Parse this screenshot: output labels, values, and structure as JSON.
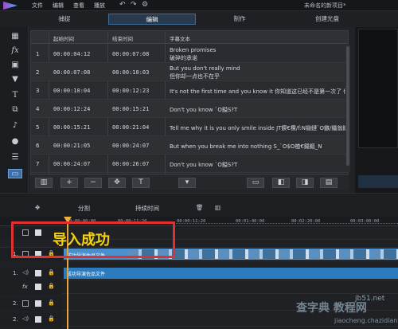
{
  "menu": {
    "items": [
      "文件",
      "编辑",
      "查看",
      "播放"
    ],
    "project_title": "未命名的新项目*"
  },
  "modes": [
    "捕捉",
    "编辑",
    "制作",
    "创建光盘"
  ],
  "active_mode": "编辑",
  "left_toolbar": {
    "icons": [
      "media-icon",
      "fx-icon",
      "overlay-icon",
      "color-icon",
      "title-icon",
      "transition-icon",
      "audio-icon",
      "record-icon",
      "chapter-icon",
      "subtitle-icon"
    ]
  },
  "subtitle_table": {
    "headers": {
      "start": "起始时间",
      "end": "结束时间",
      "text": "字幕文本"
    },
    "rows": [
      {
        "num": "1",
        "start": "00:00:04:12",
        "end": "00:00:07:08",
        "line1": "Broken promises",
        "line2": "破碎的承诺"
      },
      {
        "num": "2",
        "start": "00:00:07:08",
        "end": "00:00:10:03",
        "line1": "But you don't really mind",
        "line2": "但你却一点也不在乎"
      },
      {
        "num": "3",
        "start": "00:00:10:04",
        "end": "00:00:12:23",
        "line1": "It's not the first time and you know it 你知道这已经不是第一次了 你明白",
        "line2": ""
      },
      {
        "num": "4",
        "start": "00:00:12:24",
        "end": "00:00:15:21",
        "line1": "Don't you know `O鎰S?T",
        "line2": ""
      },
      {
        "num": "5",
        "start": "00:00:15:21",
        "end": "00:00:21:04",
        "line1": "Tell me why it is you only smile inside JT鍥€欑/f:N锄鏈`O鏃/鑷翁鐩",
        "line2": ""
      },
      {
        "num": "6",
        "start": "00:00:21:05",
        "end": "00:00:24:07",
        "line1": "But when you break me into nothing S_`O$O楂€鍚鏂_N",
        "line2": ""
      },
      {
        "num": "7",
        "start": "00:00:24:07",
        "end": "00:00:26:07",
        "line1": "Don't you know `O鎰S?T",
        "line2": ""
      }
    ]
  },
  "table_buttons": [
    "+",
    "−",
    "✥",
    "T",
    "▾"
  ],
  "timeline_tools": {
    "split": "分割",
    "duration": "持续时间"
  },
  "ruler_ticks": [
    "00:00:00:00",
    "00:00:11:20",
    "00:01:40:00",
    "00:02:20:00",
    "00:03:00:00"
  ],
  "tracks": [
    {
      "label": "1.",
      "kind": "video"
    },
    {
      "label": "1.",
      "kind": "audio"
    },
    {
      "label": "fx",
      "kind": "effect"
    },
    {
      "label": "2.",
      "kind": "overlay"
    },
    {
      "label": "2.",
      "kind": "audio"
    }
  ],
  "clips": {
    "video_label": "成功导演佐品文件",
    "audio_label": "成功导演佐品文件"
  },
  "highlight_caption": "导入成功",
  "watermark": {
    "line1": "查字典 教程网",
    "line2": "jiaocheng.chazidian.com",
    "corner": "jb51.net"
  }
}
